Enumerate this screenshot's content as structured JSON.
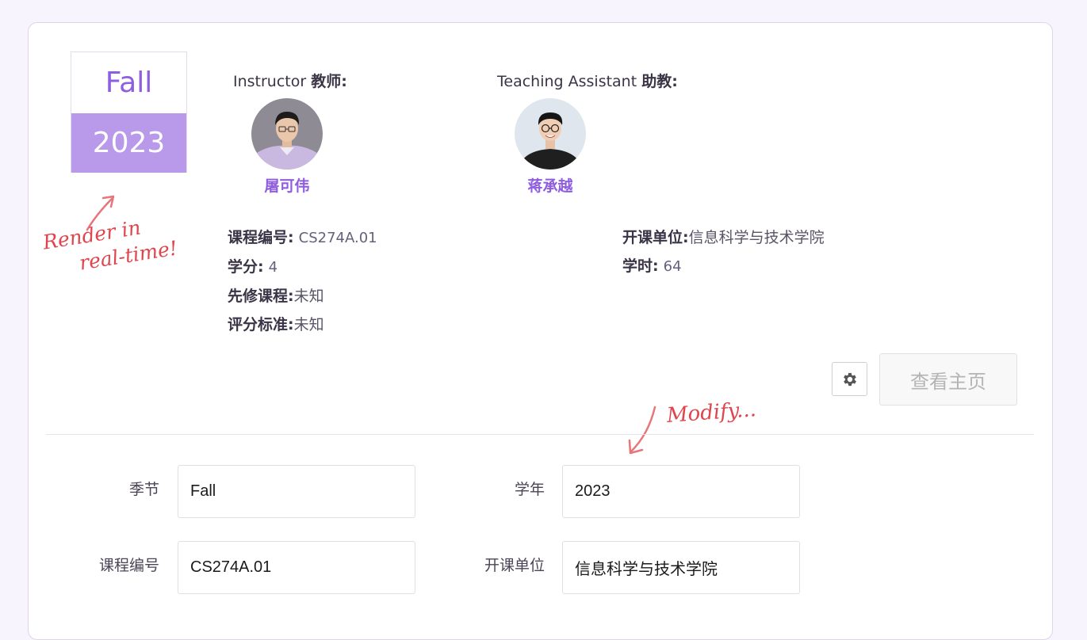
{
  "semester": {
    "season": "Fall",
    "year": "2023"
  },
  "instructor": {
    "label_en": "Instructor",
    "label_zh": "教师:",
    "name": "屠可伟"
  },
  "ta": {
    "label_en": "Teaching Assistant",
    "label_zh": "助教:",
    "name": "蒋承越"
  },
  "course_info": {
    "code_label": "课程编号:",
    "code": "CS274A.01",
    "credit_label": "学分:",
    "credit": "4",
    "prereq_label": "先修课程:",
    "prereq": "未知",
    "grading_label": "评分标准:",
    "grading": "未知",
    "dept_label": "开课单位:",
    "dept": "信息科学与技术学院",
    "hours_label": "学时:",
    "hours": "64"
  },
  "annotations": {
    "render_line1": "Render in",
    "render_line2": "real-time!",
    "modify": "Modify..."
  },
  "buttons": {
    "settings_icon": "gear-icon",
    "view_home": "查看主页"
  },
  "form": {
    "season_label": "季节",
    "season_value": "Fall",
    "year_label": "学年",
    "year_value": "2023",
    "code_label": "课程编号",
    "code_value": "CS274A.01",
    "dept_label": "开课单位",
    "dept_value": "信息科学与技术学院"
  },
  "colors": {
    "accent": "#8f5ee0",
    "badge_year_bg": "#b99aea",
    "annotation": "#e0444c",
    "page_bg": "#f7f4fd"
  }
}
